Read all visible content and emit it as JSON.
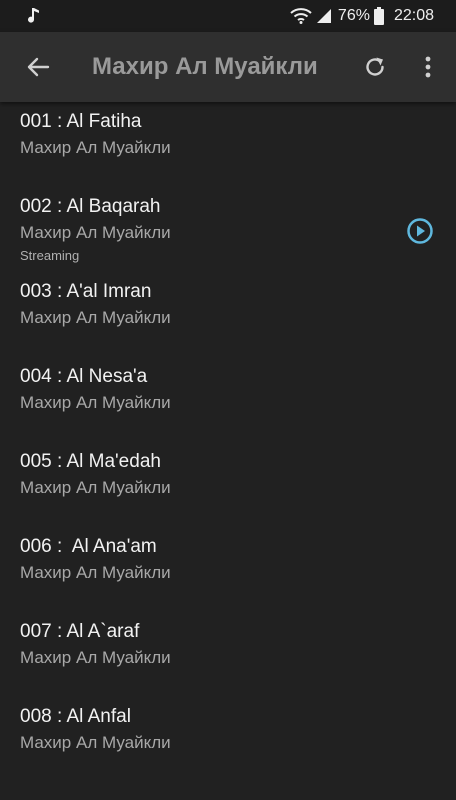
{
  "status_bar": {
    "battery": "76%",
    "time": "22:08"
  },
  "app_bar": {
    "title": "Махир Ал Муайкли"
  },
  "colors": {
    "accent": "#5fb8de",
    "background": "#212121",
    "app_bar": "#2f2f2f"
  },
  "tracks": [
    {
      "title": "001 : Al Fatiha",
      "artist": "Махир Ал Муайкли"
    },
    {
      "title": "002 : Al Baqarah",
      "artist": "Махир Ал Муайкли",
      "status": "Streaming"
    },
    {
      "title": "003 : A'al Imran",
      "artist": "Махир Ал Муайкли"
    },
    {
      "title": "004 : Al Nesa'a",
      "artist": "Махир Ал Муайкли"
    },
    {
      "title": "005 : Al Ma'edah",
      "artist": "Махир Ал Муайкли"
    },
    {
      "title": "006 :  Al Ana'am",
      "artist": "Махир Ал Муайкли"
    },
    {
      "title": "007 : Al A`araf",
      "artist": "Махир Ал Муайкли"
    },
    {
      "title": "008 : Al Anfal",
      "artist": "Махир Ал Муайкли"
    }
  ],
  "icons": {
    "status_left": "music-note-icon",
    "status_right": [
      "wifi-icon",
      "signal-icon",
      "battery-icon"
    ],
    "app_bar": [
      "back-arrow-icon",
      "refresh-icon",
      "more-vert-icon"
    ],
    "playing": "play-circle-icon"
  }
}
